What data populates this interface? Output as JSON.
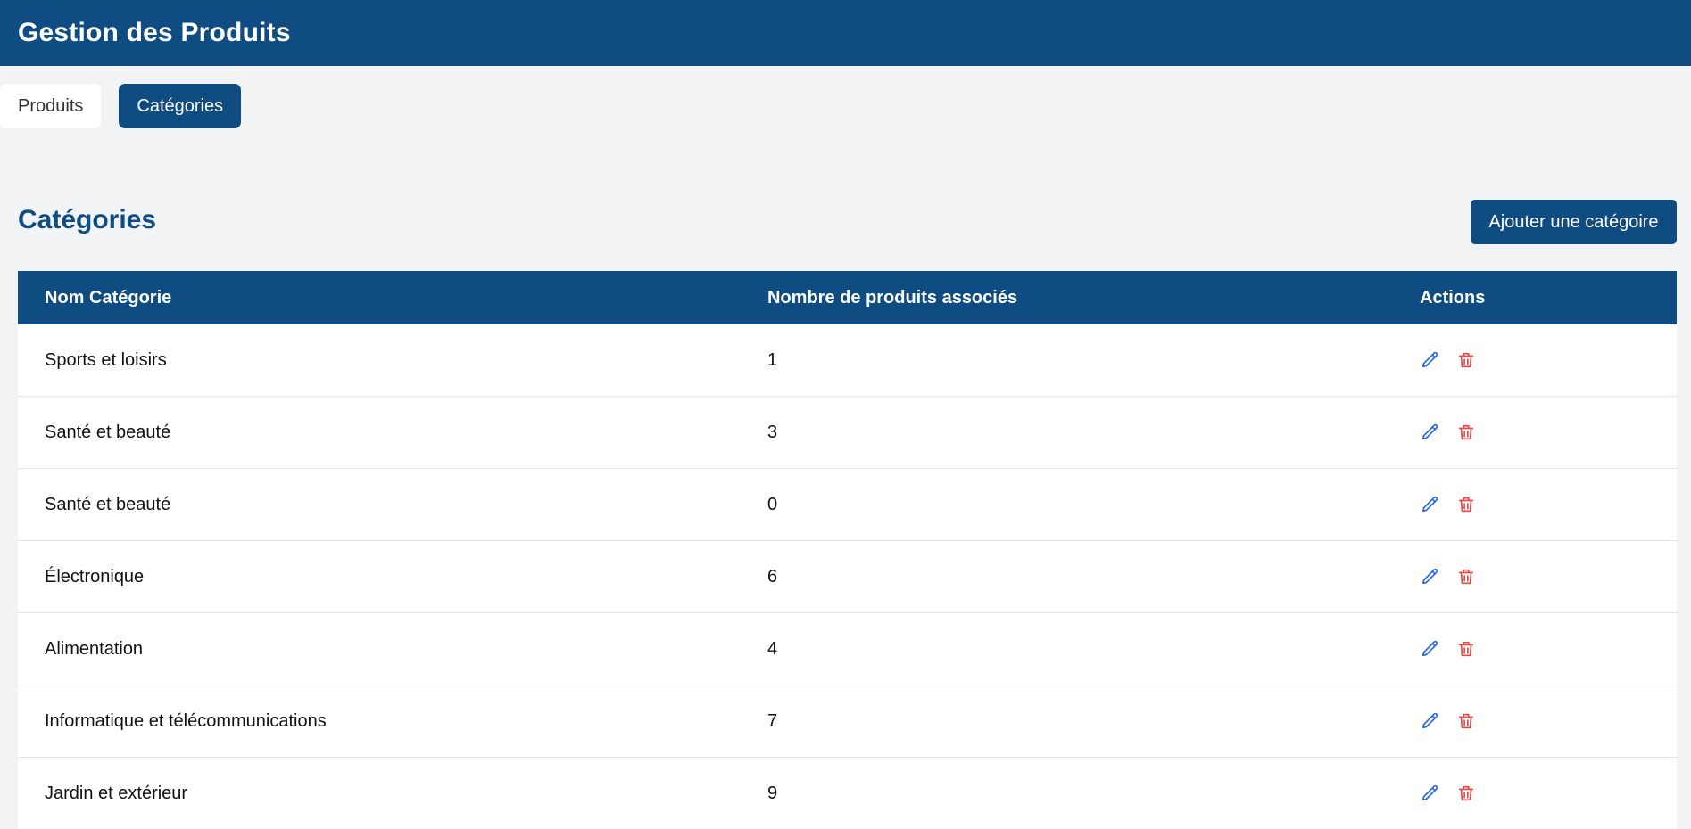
{
  "header": {
    "title": "Gestion des Produits"
  },
  "tabs": [
    {
      "label": "Produits",
      "active": false
    },
    {
      "label": "Catégories",
      "active": true
    }
  ],
  "section": {
    "title": "Catégories",
    "add_button_label": "Ajouter une catégoire"
  },
  "table": {
    "columns": [
      "Nom Catégorie",
      "Nombre de produits associés",
      "Actions"
    ],
    "rows": [
      {
        "name": "Sports et loisirs",
        "count": "1"
      },
      {
        "name": "Santé et beauté",
        "count": "3"
      },
      {
        "name": "Santé et beauté",
        "count": "0"
      },
      {
        "name": "Électronique",
        "count": "6"
      },
      {
        "name": "Alimentation",
        "count": "4"
      },
      {
        "name": "Informatique et télécommunications",
        "count": "7"
      },
      {
        "name": "Jardin et extérieur",
        "count": "9"
      }
    ],
    "row_actions": [
      {
        "icon": "pencil-icon",
        "color": "#2563eb"
      },
      {
        "icon": "trash-icon",
        "color": "#ef4444"
      }
    ]
  },
  "colors": {
    "primary": "#0f4c81",
    "background": "#f2f3f5",
    "edit": "#2563eb",
    "delete": "#ef4444"
  }
}
